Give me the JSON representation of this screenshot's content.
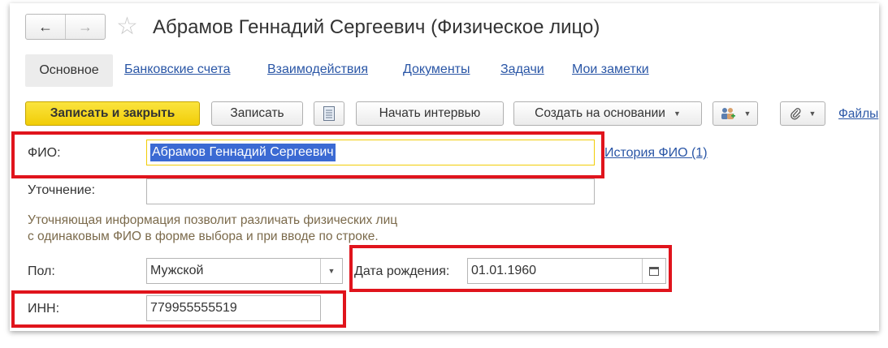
{
  "window": {
    "title": "Абрамов Геннадий Сергеевич (Физическое лицо)"
  },
  "nav": {
    "back_icon": "←",
    "forward_icon": "→",
    "favorite_icon": "☆"
  },
  "tabs": [
    {
      "label": "Основное",
      "active": true
    },
    {
      "label": "Банковские счета"
    },
    {
      "label": "Взаимодействия"
    },
    {
      "label": "Документы"
    },
    {
      "label": "Задачи"
    },
    {
      "label": "Мои заметки"
    }
  ],
  "toolbar": {
    "save_close": "Записать и закрыть",
    "save": "Записать",
    "interview": "Начать интервью",
    "create_based": "Создать на основании",
    "files": "Файлы",
    "accent": "#f1cd07"
  },
  "form": {
    "fio_label": "ФИО:",
    "fio_value": "Абрамов Геннадий Сергеевич",
    "fio_history": "История ФИО (1)",
    "clarify_label": "Уточнение:",
    "clarify_value": "",
    "hint_line1": "Уточняющая информация позволит различать физических лиц",
    "hint_line2": "с одинаковым ФИО в форме выбора и при вводе по строке.",
    "gender_label": "Пол:",
    "gender_value": "Мужской",
    "birth_label": "Дата рождения:",
    "birth_value": "01.01.1960",
    "inn_label": "ИНН:",
    "inn_value": "779955555519"
  },
  "highlight_color": "#e0141c"
}
